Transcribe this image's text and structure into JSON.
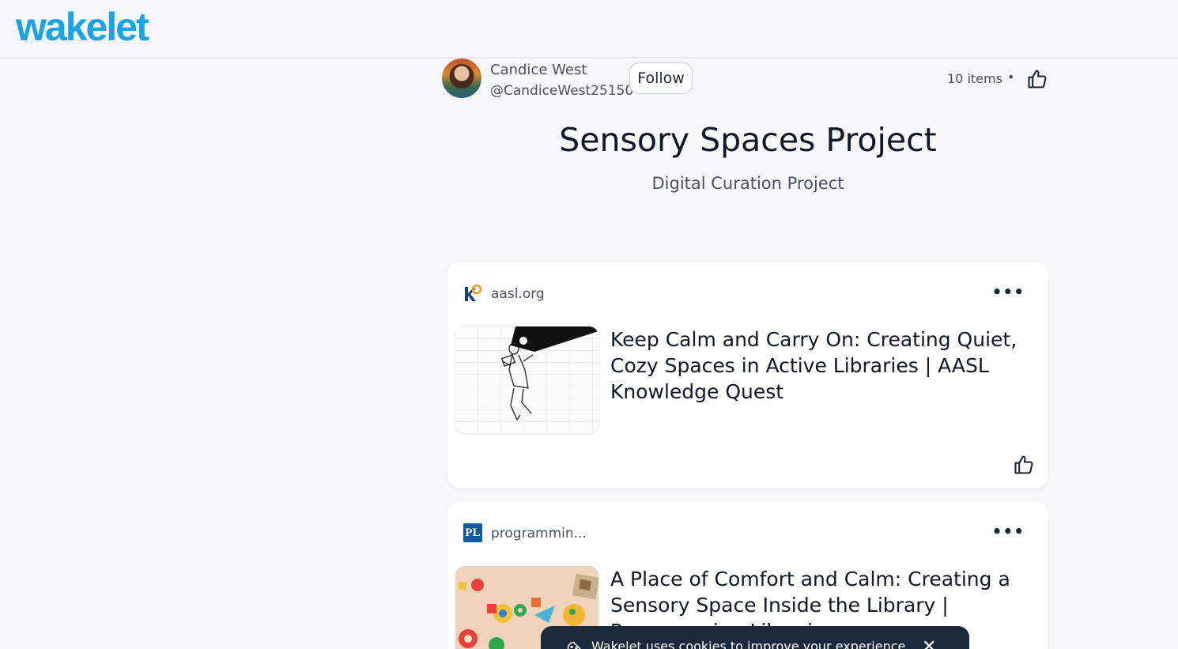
{
  "header": {
    "logo_text": "wakelet",
    "brand_color": "#1aa3e8"
  },
  "author": {
    "name": "Candice West",
    "handle": "@CandiceWest25150",
    "follow_label": "Follow"
  },
  "collection": {
    "items_count": "10 items",
    "separator": "•",
    "title": "Sensory Spaces Project",
    "subtitle": "Digital Curation Project"
  },
  "cards": [
    {
      "source": "aasl.org",
      "source_icon": "kq-logo-icon",
      "more_label": "•••",
      "title": "Keep Calm and Carry On: Creating Quiet, Cozy Spaces in Active Libraries | AASL Knowledge Quest"
    },
    {
      "source": "programmin...",
      "source_icon_text": "PL",
      "more_label": "•••",
      "title": "A Place of Comfort and Calm: Creating a Sensory Space Inside the Library | Programming Librarian"
    }
  ],
  "cookie_banner": {
    "text": "Wakelet uses cookies to improve your experience",
    "close_label": "✕"
  }
}
